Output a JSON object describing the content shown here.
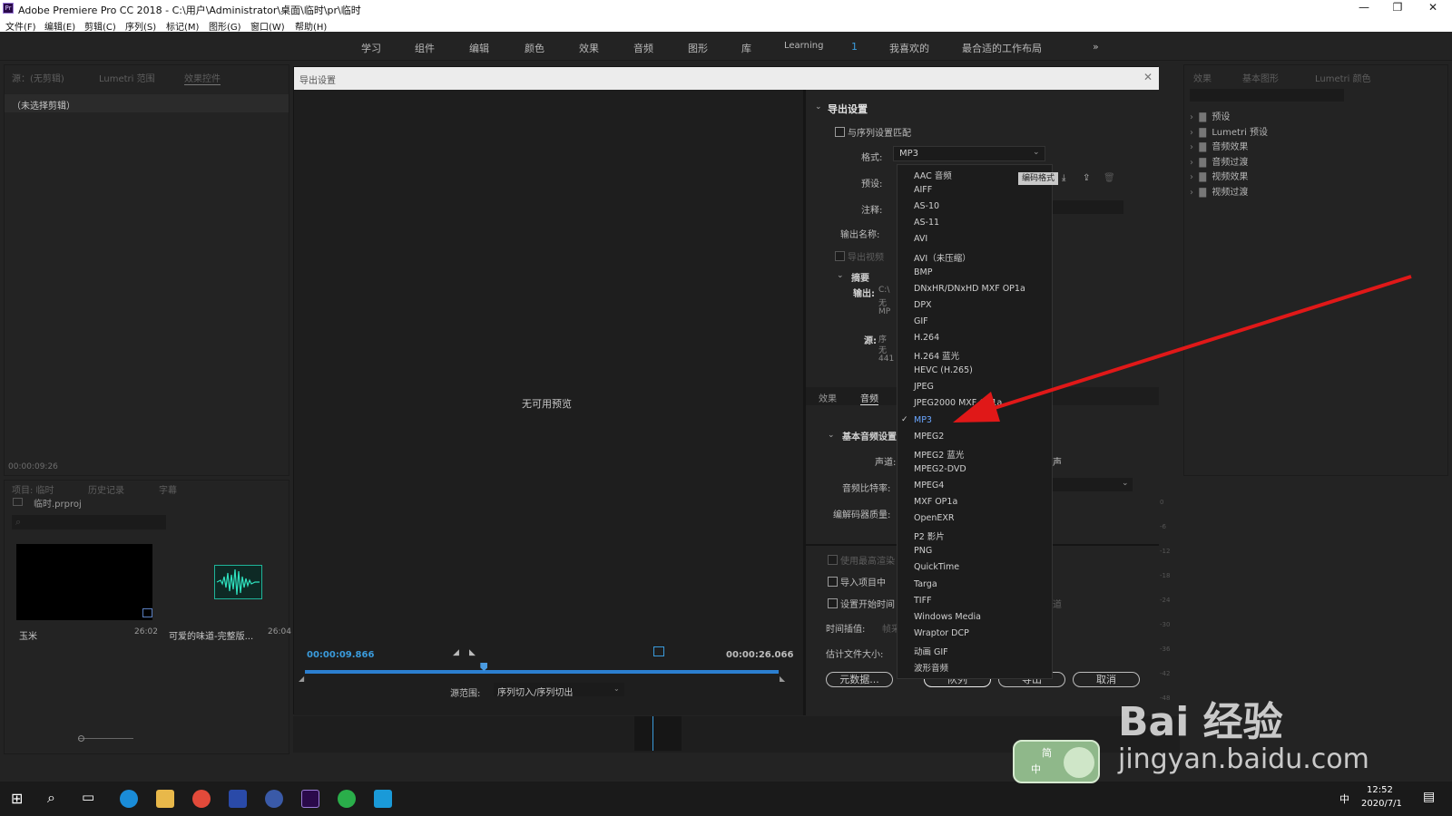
{
  "window": {
    "title": "Adobe Premiere Pro CC 2018 - C:\\用户\\Administrator\\桌面\\临时\\pr\\临时",
    "logo": "Pr",
    "controls": [
      "—",
      "❐",
      "✕"
    ]
  },
  "menubar": [
    "文件(F)",
    "编辑(E)",
    "剪辑(C)",
    "序列(S)",
    "标记(M)",
    "图形(G)",
    "窗口(W)",
    "帮助(H)"
  ],
  "workspaces": {
    "items": [
      "学习",
      "组件",
      "编辑",
      "颜色",
      "效果",
      "音频",
      "图形",
      "库",
      "Learning"
    ],
    "badge": "1",
    "favorites": "我喜欢的",
    "best": "最合适的工作布局",
    "more": "»"
  },
  "left_top_panel": {
    "tabs": [
      "源：(无剪辑)",
      "Lumetri 范围",
      "效果控件"
    ],
    "content_label": "（未选择剪辑）",
    "timecode": "00:00:09:26"
  },
  "project_panel": {
    "tabs": [
      "项目: 临时",
      "历史记录",
      "字幕"
    ],
    "project_file": "临时.prproj",
    "items": [
      {
        "name": "玉米",
        "duration": "26:02"
      },
      {
        "name": "可爱的味道-完整版...",
        "duration": "26:04"
      }
    ]
  },
  "right_panel": {
    "tabs": [
      "效果",
      "基本图形",
      "Lumetri 颜色"
    ],
    "tree": [
      "预设",
      "Lumetri 预设",
      "音频效果",
      "音频过渡",
      "视频效果",
      "视频过渡"
    ]
  },
  "timeline_scale": [
    "0",
    "-6",
    "-12",
    "-18",
    "-24",
    "-30",
    "-36",
    "-42",
    "-48"
  ],
  "dialog": {
    "title": "导出设置",
    "close": "✕",
    "preview": {
      "no_preview": "无可用预览",
      "current_time": "00:00:09.866",
      "end_time": "00:00:26.066",
      "playhead_position": 0.378,
      "source_range_label": "源范围:",
      "source_range_value": "序列切入/序列切出"
    },
    "export_settings": {
      "section_title": "导出设置",
      "match_sequence": "与序列设置匹配",
      "format_label": "格式:",
      "format_value": "MP3",
      "preset_label": "预设:",
      "tooltip": "编码格式",
      "comment_label": "注释:",
      "output_name_label": "输出名称:",
      "export_video": "导出视频",
      "summary_title": "摘要",
      "output_label": "输出:",
      "output_lines": [
        "C:\\",
        "无",
        "MP"
      ],
      "source_label": "源:",
      "source_lines": [
        "序",
        "无",
        "441"
      ]
    },
    "tabs": [
      "效果",
      "音频"
    ],
    "basic_audio": {
      "title": "基本音频设置",
      "channel_label": "声道:",
      "channel_value": "声",
      "bitrate_label": "音频比特率:",
      "codec_label": "编解码器质量:"
    },
    "bottom_options": {
      "max_render": "使用最高渲染",
      "import_project": "导入项目中",
      "set_start": "设置开始时间",
      "set_start_suffix": "道",
      "interp_label": "时间插值:",
      "interp_value": "帧采",
      "filesize_label": "估计文件大小:",
      "filesize_value": "4"
    },
    "buttons": {
      "metadata": "元数据...",
      "queue": "队列",
      "export": "导出",
      "cancel": "取消"
    },
    "format_options": [
      "AAC 音频",
      "AIFF",
      "AS-10",
      "AS-11",
      "AVI",
      "AVI（未压缩）",
      "BMP",
      "DNxHR/DNxHD MXF OP1a",
      "DPX",
      "GIF",
      "H.264",
      "H.264 蓝光",
      "HEVC (H.265)",
      "JPEG",
      "JPEG2000 MXF OP1a",
      "MP3",
      "MPEG2",
      "MPEG2 蓝光",
      "MPEG2-DVD",
      "MPEG4",
      "MXF OP1a",
      "OpenEXR",
      "P2 影片",
      "PNG",
      "QuickTime",
      "Targa",
      "TIFF",
      "Windows Media",
      "Wraptor DCP",
      "动画 GIF",
      "波形音频"
    ],
    "selected_format": "MP3"
  },
  "watermark": {
    "brand": "Bai 经验",
    "url": "jingyan.baidu.com",
    "badge_top": "简",
    "badge_bottom": "中"
  },
  "taskbar": {
    "time": "12:52",
    "date": "2020/7/1",
    "ime": "中"
  },
  "colors": {
    "accent_blue": "#3a9bdc",
    "selected_text": "#6aa6ff",
    "arrow_red": "#e01818"
  }
}
